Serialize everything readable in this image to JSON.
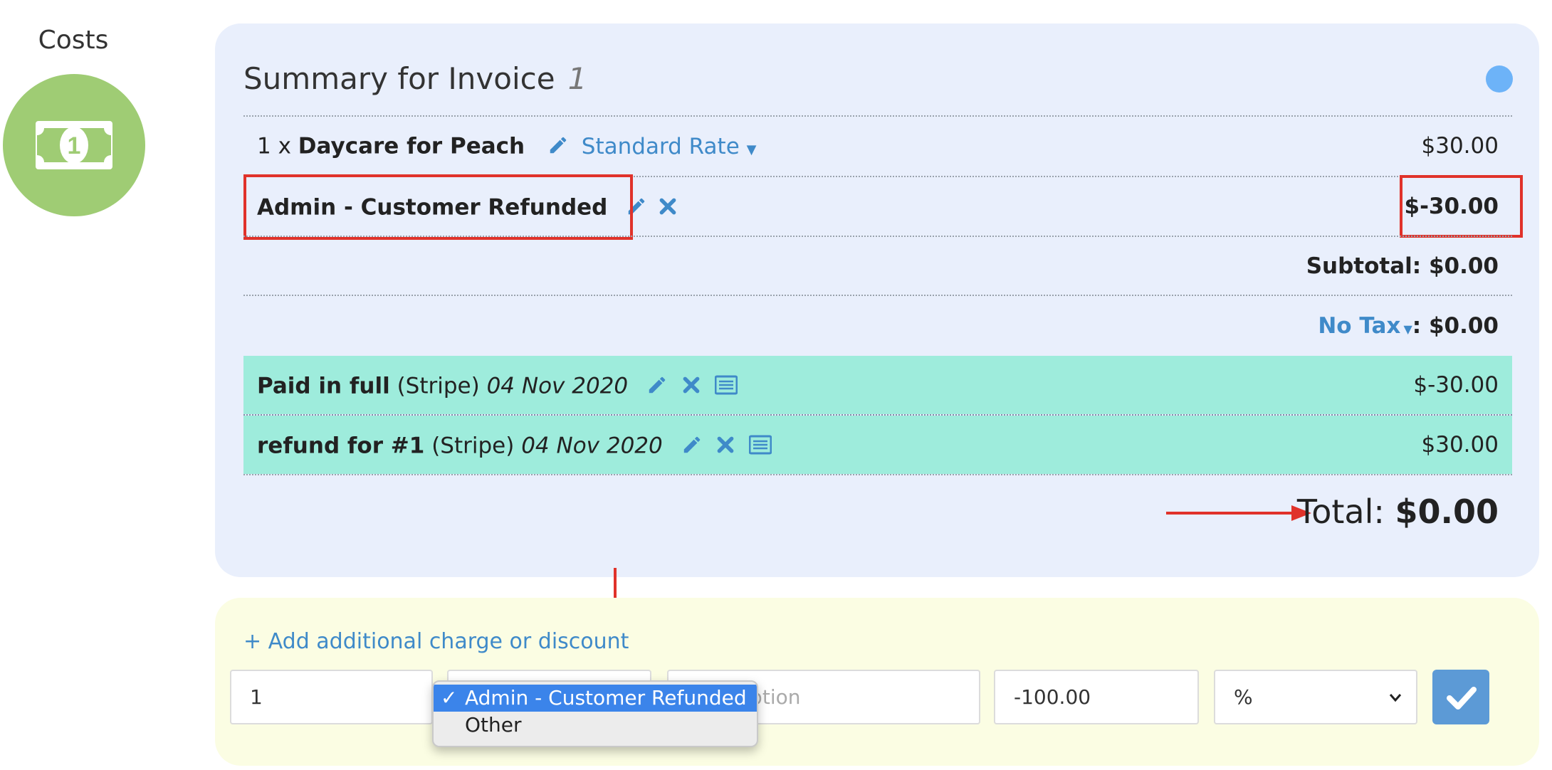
{
  "sidebar": {
    "costs_label": "Costs",
    "icon": "dollar-bill-icon",
    "icon_bg": "#9fcc74"
  },
  "summary": {
    "title": "Summary for Invoice",
    "invoice_number": "1",
    "line_item": {
      "qty_prefix": "1 x",
      "name": "Daycare for Peach",
      "rate_label": "Standard Rate",
      "amount": "$30.00"
    },
    "adjustment": {
      "name": "Admin - Customer Refunded",
      "amount": "$-30.00"
    },
    "subtotal": "Subtotal: $0.00",
    "tax": {
      "label": "No Tax",
      "amount": ": $0.00"
    },
    "payments": [
      {
        "title": "Paid in full",
        "method": "(Stripe)",
        "date": "04 Nov 2020",
        "amount": "$-30.00"
      },
      {
        "title": "refund for #1",
        "method": "(Stripe)",
        "date": "04 Nov 2020",
        "amount": "$30.00"
      }
    ],
    "total_label": "Total:",
    "total_value": "$0.00"
  },
  "add_charge": {
    "link_label": "+ Add additional charge or discount",
    "quantity": "1",
    "description_placeholder": "Description",
    "amount": "-100.00",
    "unit": "%",
    "dropdown_options": [
      "Admin - Customer Refunded",
      "Other"
    ],
    "selected_option": "Admin - Customer Refunded"
  },
  "colors": {
    "accent_blue": "#3f8ac9",
    "paid_band": "#9eecdc",
    "panel_blue": "#e9effc",
    "panel_yellow": "#fbfde3",
    "annotation_red": "#e0322a"
  }
}
